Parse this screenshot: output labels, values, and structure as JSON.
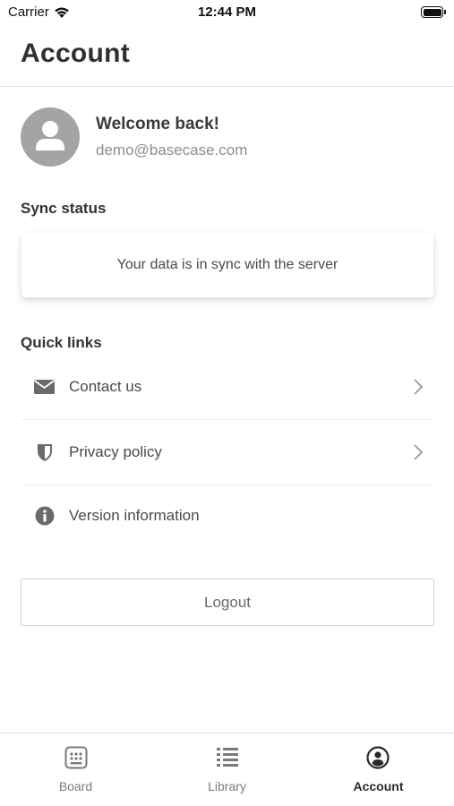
{
  "status_bar": {
    "carrier": "Carrier",
    "time": "12:44 PM"
  },
  "header": {
    "title": "Account"
  },
  "profile": {
    "welcome": "Welcome back!",
    "email": "demo@basecase.com"
  },
  "sync": {
    "section_label": "Sync status",
    "message": "Your data is in sync with the server"
  },
  "quick_links": {
    "section_label": "Quick links",
    "items": [
      {
        "label": "Contact us",
        "icon": "envelope-icon"
      },
      {
        "label": "Privacy policy",
        "icon": "shield-icon"
      },
      {
        "label": "Version information",
        "icon": "info-icon"
      }
    ]
  },
  "logout_label": "Logout",
  "tabs": [
    {
      "label": "Board",
      "icon": "grid-icon",
      "active": false
    },
    {
      "label": "Library",
      "icon": "list-icon",
      "active": false
    },
    {
      "label": "Account",
      "icon": "user-circle-icon",
      "active": true
    }
  ]
}
